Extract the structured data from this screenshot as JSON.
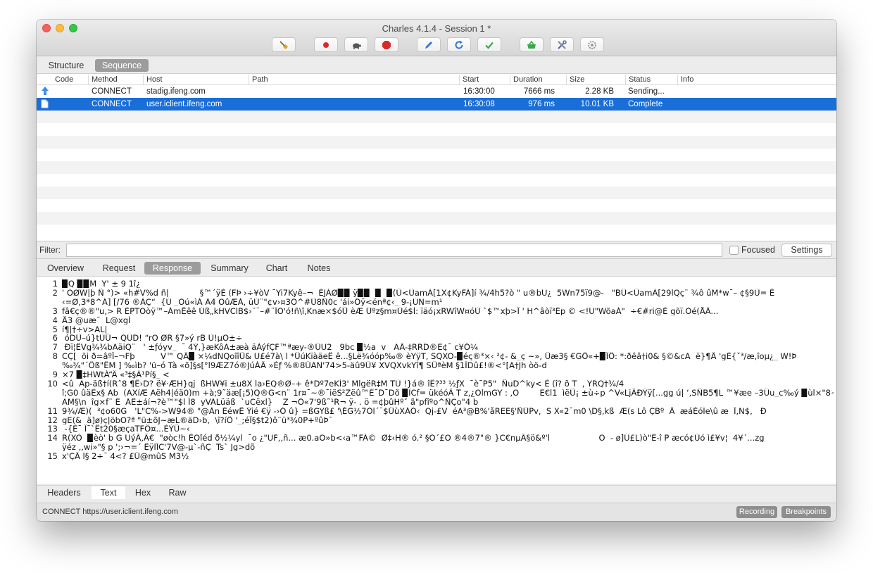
{
  "window": {
    "title": "Charles 4.1.4 - Session 1 *"
  },
  "toolbar": {
    "buttons": [
      {
        "name": "broom-icon",
        "color": "#e2a21d"
      },
      {
        "name": "record-icon",
        "color": "#d92a2a"
      },
      {
        "name": "throttle-turtle-icon",
        "color": "#555555"
      },
      {
        "name": "breakpoint-stop-icon",
        "color": "#d92a2a"
      },
      {
        "name": "compose-pen-icon",
        "color": "#2f7ad8"
      },
      {
        "name": "repeat-refresh-icon",
        "color": "#2f7ad8"
      },
      {
        "name": "validate-check-icon",
        "color": "#3aa84a"
      },
      {
        "name": "basket-icon",
        "color": "#3aa84a"
      },
      {
        "name": "tools-icon",
        "color": "#4a6fa5"
      },
      {
        "name": "settings-gear-icon",
        "color": "#9a9a9a"
      }
    ]
  },
  "view_tabs": [
    "Structure",
    "Sequence"
  ],
  "table": {
    "headers": [
      "Code",
      "Method",
      "Host",
      "Path",
      "Start",
      "Duration",
      "Size",
      "Status",
      "Info"
    ],
    "rows": [
      {
        "icon": "upload-arrow-icon",
        "code": "",
        "method": "CONNECT",
        "host": "stadig.ifeng.com",
        "path": "",
        "start": "16:30:00",
        "duration": "7666 ms",
        "size": "2.28 KB",
        "status": "Sending...",
        "info": ""
      },
      {
        "icon": "document-icon",
        "code": "",
        "method": "CONNECT",
        "host": "user.iclient.ifeng.com",
        "path": "",
        "start": "16:30:08",
        "duration": "976 ms",
        "size": "10.01 KB",
        "status": "Complete",
        "info": ""
      }
    ]
  },
  "filter": {
    "label": "Filter:",
    "value": "",
    "focused_label": "Focused",
    "settings_label": "Settings"
  },
  "detail_tabs": [
    "Overview",
    "Request",
    "Response",
    "Summary",
    "Chart",
    "Notes"
  ],
  "content_lines": [
    {
      "n": "1",
      "t": "▉Q ▉▉M  Y' ± 9 1î¿"
    },
    {
      "n": "2",
      "t": "' ÒØW|þ Ñ °)> «h#V%d ñ|            §™´ÿÈ (FÞ ›÷¥òV ¯Yi7Kyê–¬  ÉJÀØ▉▉ ÿ▉▉  ▉  ▉(Û<ÛamÁ[1X¢KyFÀ]í ¾/4h5?ò \" u®bU¿  5Wn75ï9@-   \"BÛ<ÛamÁ[29lQç¨ ¾ô ûM*w¯– ¢§9Ù= Ê"
    },
    {
      "n": "",
      "t": "‹=Ø,3*8^Á] [/76 ®ÁÇ“  {Ú _Òú«ìÁ À4 OûÆÀ, üÙ¨\"¢v›¤3Ò^#Û8Ñ0c 'ái»Öÿ<énª¢‹_ 9-¡ÚN=m¹"
    },
    {
      "n": "3",
      "t": "fâ€ç®®\"u,> R ÈPTOòÿ™–ÁmÊêê Úß„kHVClB$›¨¯–#¨ÏÕ'­ó!ñ\\î,Knæ×$óÜ èÆ Ûºz§m¤Úé$Í: ïäó¡xRWîW¤óÚ `$™xþ>Î ' H^âòï³Ép © <!U\"WõaÁ\"  ÷€#ri@É gõï.Óé(ÅÄ..."
    },
    {
      "n": "4",
      "t": "Ã3 @uæ¯  L@xgÍ"
    },
    {
      "n": "5",
      "t": "í¶|†÷v>AL|"
    },
    {
      "n": "6",
      "t": " óDÛ–ú}tÙÜ¬ QÛD! “rÕ ØR §7»ý rB Ù!µÕ±÷"
    },
    {
      "n": "7",
      "t": " Ðï¦ËVg¾¾bAäiQ¨   ' ±ƒóyv_  ¯ 4Ý,}æKôA±æà äÀýfÇF™ªæy-®ÛU2   9bc ▉½a  v   AÄ-‡RRD®E¢¯ c¥Ö¼"
    },
    {
      "n": "8",
      "t": "CÇ[  õi ð=âºÎ–¬Fþ          V™ QÄ▉ ×¼dNQoîîÜ& U£é7à\\ l *ÜúKïàäeË ê...§Lë¾óóp‰® èYÿT, SQXO-▉éç®³×‹ ²¢- &_ç ~», Üæ3§ €GÖ«+▉ÏÖ: *:ðêâ†i0& §©&cA  ë}¶Â 'gÈ{ˇ³/æ,îoµ¿_ W!Þ"
    },
    {
      "n": "",
      "t": "‰¾\"´Öß\"ËM ] ‰ìb? 'ü–ó Tà «õ]§s[°l9ÆZ7ó®JúÁÄ »Èƒ %®8ÛAN'74>5-äû9Û¥ XVQXvkYî¶ SÜªèM §1ÎDû£!®<°[A†Jh òö-d"
    },
    {
      "n": "9",
      "t": "×7 ▉‡HWtÀ“Ä «³‡§Á¹Pí§_ <"
    },
    {
      "n": "10",
      "t": "<û  Ap-äß†í(Rˆ8 ¶Ê›D? ë¥·ÆH}qj  ßHW¥i ±u8X la›EQ®Ø–+ ê*Dº7eKÍ3' MlgëR‡M TÙ !}á® îÊ?³³ ½ƒX  ¯è¯P5\"  ÑuD^ky< È (î? õ T  , YRQ†¾/4"
    },
    {
      "n": "",
      "t": "î;G0 ûäËx§ Ab  (AXíÆ Aëh4|éä0)m +à;9˜äæ[¡5)Q®G<n¨ 1r¤¯~®¯iëS²Zëû™É¯D¯Dõ ▉ÎCf= ükéóÂ T z,¿ÕlmGY : ,Õ        E€l1  ìëÜ¡ ±ù÷p ^V«LjÃÐÝÿ[...gg ú| ‘,SÑB5¶L ™¥æe –3Ûu_c‰ý ▉ùl×\"8~"
    },
    {
      "n": "",
      "t": "AM§\\n  îg×f¨ È  ÂË±áí¬?è™\"$l Î8  yVÀLüäß  `uCëxl}    Z ¬Ö«7'9ß˜¹R¬ ÿ- . ö =¢þûHºˇ ã\"pfîºo^ÑÇo\"4 b"
    },
    {
      "n": "11",
      "t": "9¾/Æ)(  ³¢o60G   'L\"C%->W94® \"@Àn ÈéwÊ Ýié €ÿ -›Ó û} =ßGYß£ '\\ÉG½7Òl´¯$ÜùXÁÓ‹  Qj-£V  éA³@B%'åREE§'ÑÛPv,  S X«2¯m0 \\D§,kß  Æ(s Lô ÇBº  Â  æáÉóle\\û æ  Î,N$,   Ð"
    },
    {
      "n": "12",
      "t": "gE(&  ä]ø)ç|öbO?ª \"ü±õJ~æL®äD›b,  \\î?íÔ '_;éÎ§$t2)ô¨ü³¾0P+ºûÞ¯"
    },
    {
      "n": "13",
      "t": " -{È¯ Î¯`Êt20§æçaTFÖ¤...ÉÝÜ~‹"
    },
    {
      "n": "14",
      "t": "R(XÒ  ▉èò' b G UýÃ,Â€  \"øòc!h ÊÒîéd ð½¼yl  ¯o ¿\"UF,,ñ... æ0.aO»b<‹a™FÁ©  Ø‡‹H® ó.² §Ó´£O ®4®7\"® }C€nµÄ§ö&º'l                   Ò  - ø]Ú£L)ò\"Ë-î P æcó¢Úó ì£¥v¦  4¥´...zg"
    },
    {
      "n": "",
      "t": "ÿéz ,,wi»\"§ p ';›¬=´ ËÿlÎC'7V@-µ`-ñÇ  Ts` Jg>dõ"
    },
    {
      "n": "15",
      "t": "x'ÇÄ l§ 2÷¯ 4<? £Ü@mûS M3½"
    }
  ],
  "body_tabs": [
    "Headers",
    "Text",
    "Hex",
    "Raw"
  ],
  "status": {
    "text": "CONNECT https://user.iclient.ifeng.com",
    "recording_label": "Recording",
    "breakpoints_label": "Breakpoints"
  }
}
